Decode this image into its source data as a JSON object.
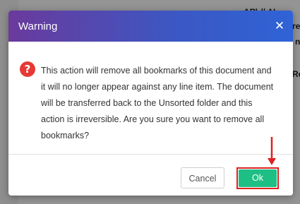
{
  "background": {
    "fragments": [
      "ΔR\\ // ΛΙ",
      "re",
      "n",
      "Re"
    ]
  },
  "dialog": {
    "title": "Warning",
    "close_icon": "close-icon",
    "warning_icon": "error-circle-icon",
    "message": "This action will remove all bookmarks of this document and it will no longer appear against any line item. The document will be transferred back to the Unsorted folder and this action is irreversible. Are you sure you want to remove all bookmarks?",
    "cancel_label": "Cancel",
    "ok_label": "Ok"
  },
  "annotation": {
    "arrow_color": "#e02020",
    "highlight_target": "Ok"
  },
  "colors": {
    "header_start": "#6a3a9c",
    "header_end": "#2f63d6",
    "ok_button": "#1ebf85",
    "warning_icon": "#e53935"
  }
}
